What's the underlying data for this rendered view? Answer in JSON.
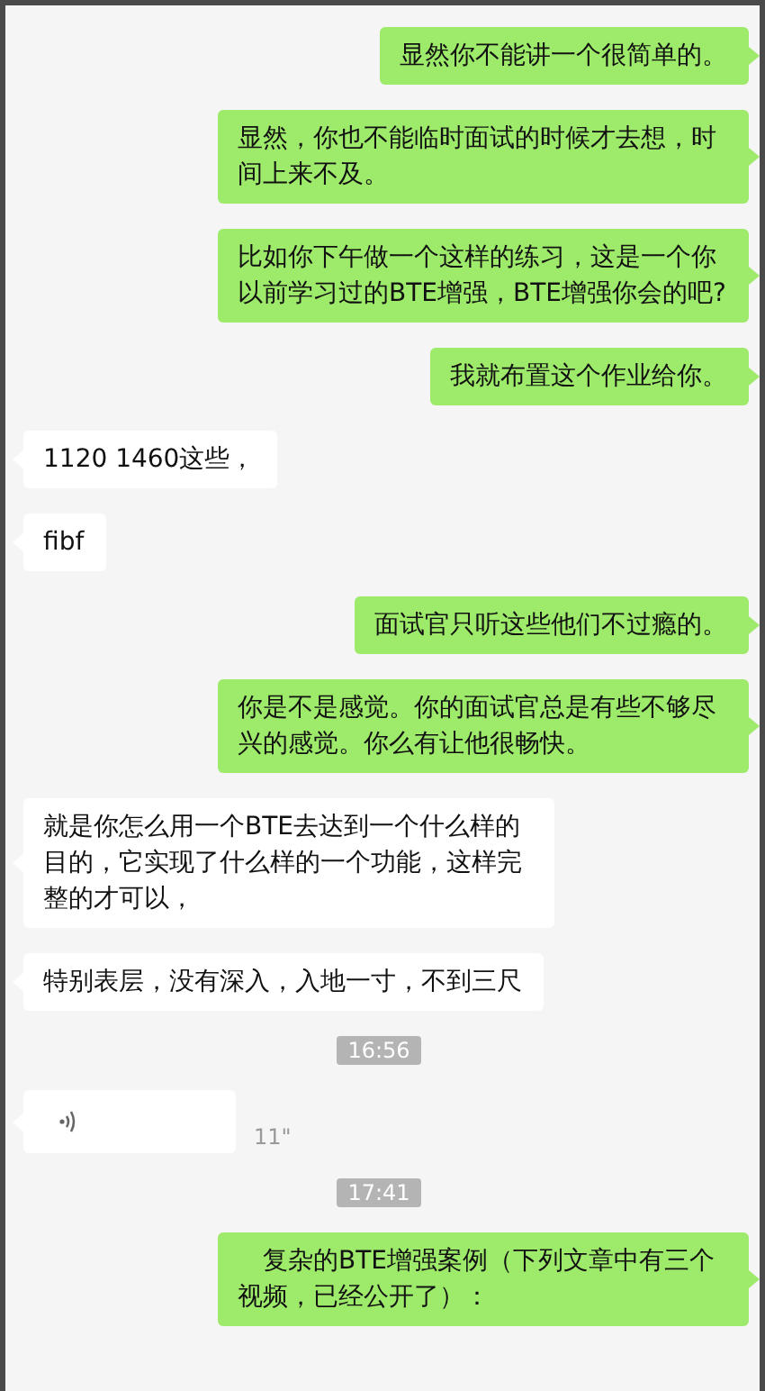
{
  "messages": [
    {
      "kind": "sent",
      "text": "显然你不能讲一个很简单的。"
    },
    {
      "kind": "sent",
      "text": "显然，你也不能临时面试的时候才去想，时间上来不及。"
    },
    {
      "kind": "sent",
      "text": "比如你下午做一个这样的练习，这是一个你以前学习过的BTE增强，BTE增强你会的吧?"
    },
    {
      "kind": "sent",
      "text": "我就布置这个作业给你。"
    },
    {
      "kind": "received",
      "text": "1120 1460这些，"
    },
    {
      "kind": "received",
      "text": "fibf"
    },
    {
      "kind": "sent",
      "text": "面试官只听这些他们不过瘾的。"
    },
    {
      "kind": "sent",
      "text": "你是不是感觉。你的面试官总是有些不够尽兴的感觉。你么有让他很畅快。"
    },
    {
      "kind": "received",
      "text": "就是你怎么用一个BTE去达到一个什么样的目的，它实现了什么样的一个功能，这样完整的才可以，"
    },
    {
      "kind": "received",
      "text": "特别表层，没有深入，入地一寸，不到三尺"
    },
    {
      "kind": "time",
      "text": "16:56"
    },
    {
      "kind": "voice",
      "duration": "11\""
    },
    {
      "kind": "time",
      "text": "17:41"
    },
    {
      "kind": "sent",
      "text": "复杂的BTE增强案例（下列文章中有三个视频，已经公开了）："
    }
  ]
}
